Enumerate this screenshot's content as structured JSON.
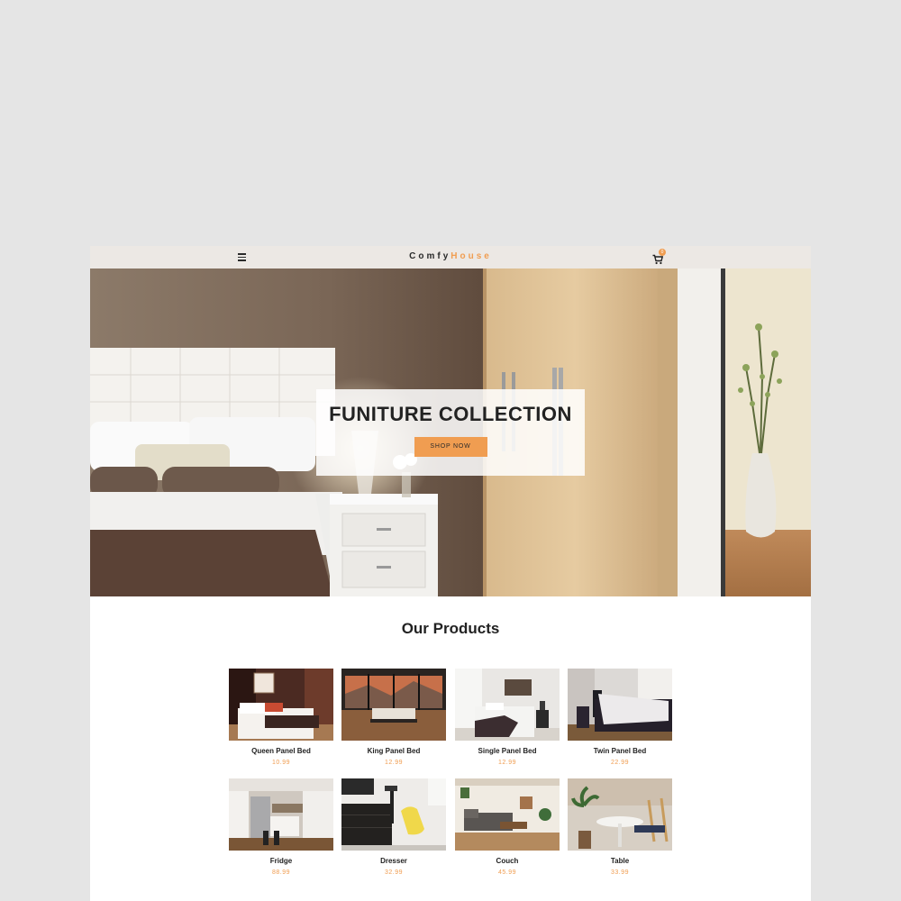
{
  "navbar": {
    "logo_part1": "Comfy",
    "logo_part2": "House",
    "cart_count": "0",
    "menu_icon": "hamburger-icon",
    "cart_icon": "cart-icon"
  },
  "hero": {
    "title": "FUNITURE COLLECTION",
    "button_label": "SHOP NOW"
  },
  "products_section": {
    "title": "Our Products",
    "items": [
      {
        "name": "Queen Panel Bed",
        "price": "10.99"
      },
      {
        "name": "King Panel Bed",
        "price": "12.99"
      },
      {
        "name": "Single Panel Bed",
        "price": "12.99"
      },
      {
        "name": "Twin Panel Bed",
        "price": "22.99"
      },
      {
        "name": "Fridge",
        "price": "88.99"
      },
      {
        "name": "Dresser",
        "price": "32.99"
      },
      {
        "name": "Couch",
        "price": "45.99"
      },
      {
        "name": "Table",
        "price": "33.99"
      }
    ]
  },
  "colors": {
    "accent": "#f09d51",
    "navbar_bg": "#ece8e4",
    "page_bg": "#e5e5e5"
  }
}
